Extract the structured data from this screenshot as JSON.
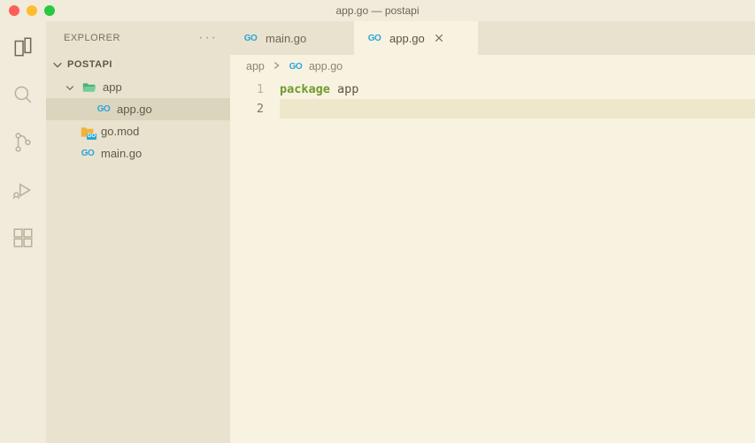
{
  "window": {
    "title": "app.go — postapi"
  },
  "sidebar": {
    "title": "EXPLORER",
    "section": "POSTAPI",
    "tree": {
      "folder_app": "app",
      "file_app_go": "app.go",
      "file_go_mod": "go.mod",
      "file_main_go": "main.go"
    }
  },
  "tabs": {
    "main_go": "main.go",
    "app_go": "app.go"
  },
  "breadcrumbs": {
    "crumb_app": "app",
    "crumb_file": "app.go"
  },
  "editor": {
    "lines": {
      "n1": "1",
      "n2": "2"
    },
    "line1_keyword": "package",
    "line1_ident": " app"
  }
}
